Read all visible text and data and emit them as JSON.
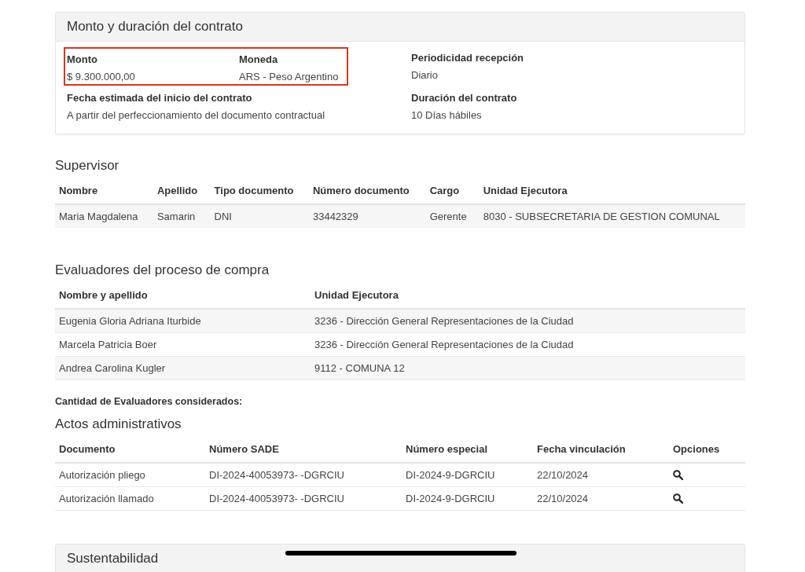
{
  "contract_card": {
    "title": "Monto y duración del contrato",
    "highlighted_fields": [
      {
        "label": "Monto",
        "value": "$ 9.300.000,00"
      },
      {
        "label": "Moneda",
        "value": "ARS - Peso Argentino"
      }
    ],
    "fields": [
      {
        "label": "Periodicidad recepción",
        "value": "Diario"
      },
      {
        "label": "Fecha estimada del inicio del contrato",
        "value": "A partir del perfeccionamiento del documento contractual"
      },
      {
        "label": "Duración del contrato",
        "value": "10 Días hábiles"
      }
    ]
  },
  "supervisor": {
    "title": "Supervisor",
    "columns": [
      "Nombre",
      "Apellido",
      "Tipo documento",
      "Número documento",
      "Cargo",
      "Unidad Ejecutora"
    ],
    "rows": [
      [
        "Maria Magdalena",
        "Samarin",
        "DNI",
        "33442329",
        "Gerente",
        "8030 - SUBSECRETARIA DE GESTION COMUNAL"
      ]
    ]
  },
  "evaluators": {
    "title": "Evaluadores del proceso de compra",
    "columns": [
      "Nombre y apellido",
      "Unidad Ejecutora"
    ],
    "rows": [
      [
        "Eugenia Gloria Adriana Iturbide",
        "3236 - Dirección General Representaciones de la Ciudad"
      ],
      [
        "Marcela Patricia Boer",
        "3236 - Dirección General Representaciones de la Ciudad"
      ],
      [
        "Andrea Carolina Kugler",
        "9112 - COMUNA 12"
      ]
    ],
    "count_label": "Cantidad de Evaluadores considerados:"
  },
  "acts": {
    "title": "Actos administrativos",
    "columns": [
      "Documento",
      "Número SADE",
      "Número especial",
      "Fecha vinculación",
      "Opciones"
    ],
    "rows": [
      [
        "Autorización pliego",
        "DI-2024-40053973- -DGRCIU",
        "DI-2024-9-DGRCIU",
        "22/10/2024"
      ],
      [
        "Autorización llamado",
        "DI-2024-40053973- -DGRCIU",
        "DI-2024-9-DGRCIU",
        "22/10/2024"
      ]
    ]
  },
  "sustainability_card": {
    "title": "Sustentabilidad"
  }
}
